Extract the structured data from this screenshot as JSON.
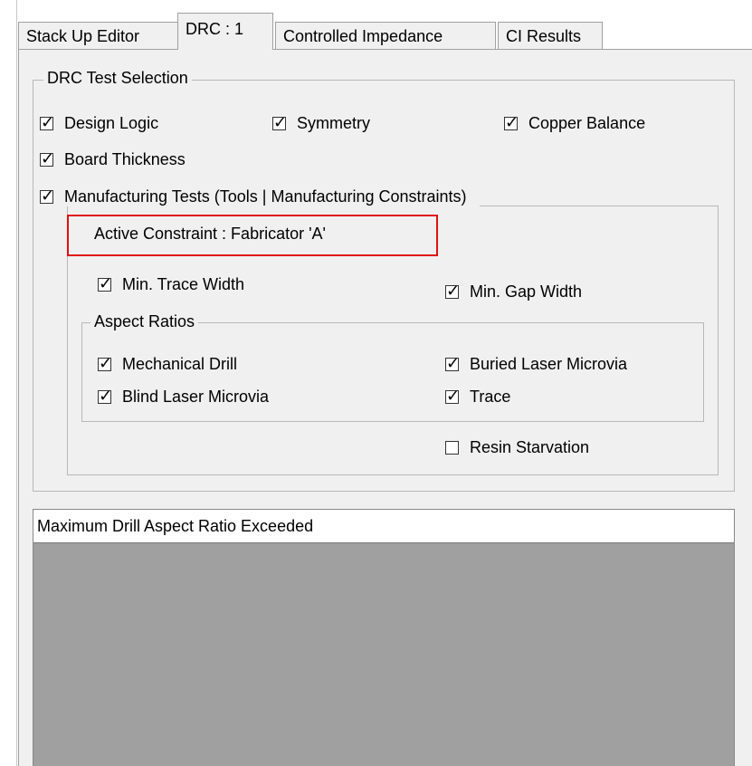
{
  "tabs": [
    {
      "label": "Stack Up Editor"
    },
    {
      "label": "DRC : 1"
    },
    {
      "label": "Controlled Impedance"
    },
    {
      "label": "CI Results"
    }
  ],
  "active_tab": "DRC : 1",
  "drc": {
    "group_title": "DRC Test Selection",
    "design_logic": {
      "label": "Design Logic",
      "checked": true
    },
    "symmetry": {
      "label": "Symmetry",
      "checked": true
    },
    "copper_balance": {
      "label": "Copper Balance",
      "checked": true
    },
    "board_thickness": {
      "label": "Board Thickness",
      "checked": true
    },
    "manufacturing": {
      "label": "Manufacturing Tests (Tools | Manufacturing Constraints)",
      "checked": true,
      "active_constraint": "Active Constraint : Fabricator 'A'",
      "min_trace_width": {
        "label": "Min. Trace Width",
        "checked": true
      },
      "min_gap_width": {
        "label": "Min. Gap Width",
        "checked": true
      },
      "aspect_ratios": {
        "title": "Aspect Ratios",
        "mechanical_drill": {
          "label": "Mechanical Drill",
          "checked": true
        },
        "buried_laser_microvia": {
          "label": "Buried Laser Microvia",
          "checked": true
        },
        "blind_laser_microvia": {
          "label": "Blind Laser Microvia",
          "checked": true
        },
        "trace": {
          "label": "Trace",
          "checked": true
        }
      },
      "resin_starvation": {
        "label": "Resin Starvation",
        "checked": false
      }
    }
  },
  "results": {
    "items": [
      "Maximum Drill Aspect Ratio Exceeded"
    ]
  },
  "colors": {
    "highlight": "#e01010",
    "panel_bg": "#f0f0f0",
    "results_bg": "#a0a0a0"
  }
}
